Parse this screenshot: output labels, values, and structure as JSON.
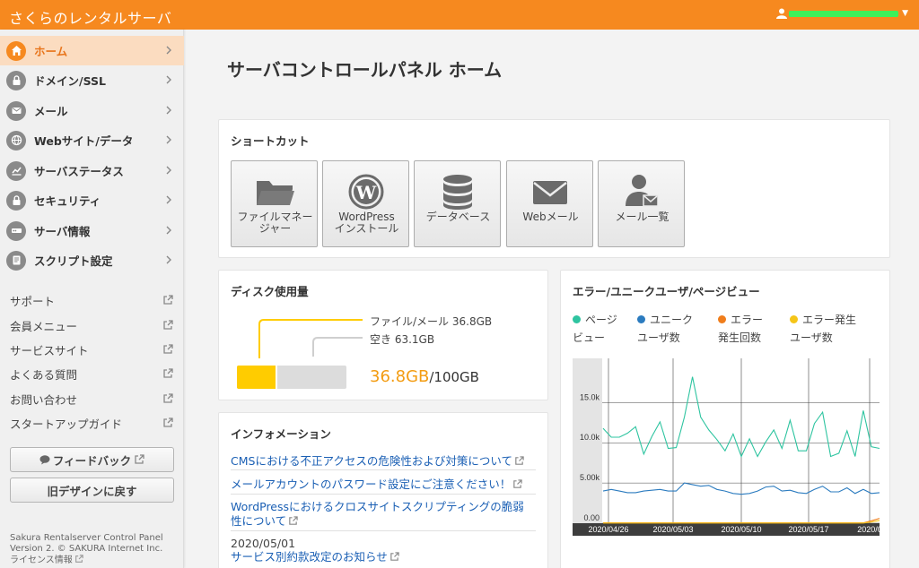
{
  "header": {
    "brand": "さくらのレンタルサーバ"
  },
  "sidebar": {
    "nav": [
      {
        "label": "ホーム",
        "icon": "home-icon"
      },
      {
        "label": "ドメイン/SSL",
        "icon": "lock-icon"
      },
      {
        "label": "メール",
        "icon": "mail-icon"
      },
      {
        "label": "Webサイト/データ",
        "icon": "globe-icon"
      },
      {
        "label": "サーバステータス",
        "icon": "chart-icon"
      },
      {
        "label": "セキュリティ",
        "icon": "lock-icon"
      },
      {
        "label": "サーバ情報",
        "icon": "server-icon"
      },
      {
        "label": "スクリプト設定",
        "icon": "script-icon"
      }
    ],
    "external": [
      "サポート",
      "会員メニュー",
      "サービスサイト",
      "よくある質問",
      "お問い合わせ",
      "スタートアップガイド"
    ],
    "feedback_label": "フィードバック",
    "old_design_label": "旧デザインに戻す",
    "footer_line1": "Sakura Rentalserver Control Panel",
    "footer_line2": "Version 2. © SAKURA Internet Inc.",
    "license_label": "ライセンス情報"
  },
  "main": {
    "title": "サーバコントロールパネル ホーム",
    "shortcut": {
      "title": "ショートカット",
      "items": [
        {
          "line1": "ファイルマネー",
          "line2": "ジャー",
          "icon": "folder-icon"
        },
        {
          "line1": "WordPress",
          "line2": "インストール",
          "icon": "wordpress-icon"
        },
        {
          "line1": "データベース",
          "line2": "",
          "icon": "database-icon"
        },
        {
          "line1": "Webメール",
          "line2": "",
          "icon": "envelope-icon"
        },
        {
          "line1": "メール一覧",
          "line2": "",
          "icon": "mail-list-icon"
        }
      ]
    },
    "disk": {
      "title": "ディスク使用量",
      "file_mail": "ファイル/メール 36.8GB",
      "free": "空き 63.1GB",
      "used": "36.8GB",
      "total": "/100GB",
      "used_fraction": 0.368,
      "used_color": "#ffcc00",
      "used_text_color": "#f39c12"
    },
    "info": {
      "title": "インフォメーション",
      "links": [
        "CMSにおける不正アクセスの危険性および対策について",
        "メールアカウントのパスワード設定にご注意ください！",
        "WordPressにおけるクロスサイトスクリプティングの脆弱",
        "性について"
      ],
      "date": "2020/05/01",
      "date_link": "サービス別約款改定のお知らせ"
    }
  },
  "chart_data": {
    "type": "line",
    "title": "エラー/ユニークユーザ/ページビュー",
    "legend": [
      {
        "line1": "ページ",
        "line2": "ビュー",
        "color": "#2ec4a0"
      },
      {
        "line1": "ユニーク",
        "line2": "ユーザ数",
        "color": "#2b7bbf"
      },
      {
        "line1": "エラー",
        "line2": "発生回数",
        "color": "#f07d1b"
      },
      {
        "line1": "エラー発生",
        "line2": "ユーザ数",
        "color": "#f5c518"
      }
    ],
    "y_ticks": [
      "15.0k",
      "10.0k",
      "5.00k",
      "0.00"
    ],
    "x_ticks": [
      "2020/04/26",
      "2020/05/03",
      "2020/05/10",
      "2020/05/17",
      "2020/0"
    ],
    "ylim": [
      0,
      20500
    ],
    "series": [
      {
        "name": "ページビュー",
        "color": "#2ec4a0",
        "values": [
          11800,
          10700,
          10700,
          11200,
          12000,
          8600,
          10800,
          12600,
          9300,
          9400,
          13200,
          18200,
          13200,
          11600,
          10400,
          9000,
          11100,
          8300,
          10500,
          8300,
          10100,
          11600,
          9300,
          12800,
          9000,
          9000,
          12400,
          13800,
          8300,
          8700,
          11500,
          8300,
          14000,
          9500,
          9300
        ]
      },
      {
        "name": "ユニークユーザ数",
        "color": "#2b7bbf",
        "values": [
          4000,
          4200,
          4000,
          3800,
          3800,
          4000,
          4100,
          4200,
          4000,
          4000,
          5000,
          4800,
          4600,
          4700,
          4200,
          4000,
          3700,
          3600,
          3700,
          4000,
          4500,
          4600,
          4000,
          4100,
          3800,
          3700,
          4200,
          4600,
          3900,
          3900,
          4400,
          3700,
          4200,
          3700,
          3800
        ]
      },
      {
        "name": "エラー発生回数",
        "color": "#f07d1b",
        "values": [
          50,
          50,
          50,
          50,
          50,
          50,
          50,
          50,
          50,
          50,
          50,
          50,
          50,
          50,
          50,
          50,
          50,
          50,
          50,
          50,
          50,
          50,
          50,
          50,
          50,
          50,
          50,
          50,
          50,
          50,
          50,
          50,
          50,
          300,
          600
        ]
      },
      {
        "name": "エラー発生ユーザ数",
        "color": "#f5c518",
        "values": [
          20,
          20,
          20,
          20,
          20,
          20,
          20,
          20,
          20,
          20,
          20,
          20,
          20,
          20,
          20,
          20,
          20,
          20,
          20,
          20,
          20,
          20,
          20,
          20,
          20,
          20,
          20,
          20,
          20,
          20,
          20,
          20,
          20,
          150,
          350
        ]
      }
    ]
  }
}
